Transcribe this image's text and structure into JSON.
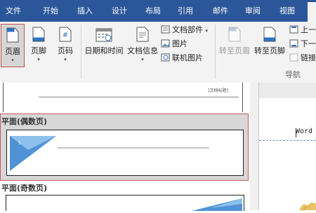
{
  "colors": {
    "ribbon_blue": "#2b579a",
    "selection_red": "#c0504d",
    "preview_blue": "#4f93d6"
  },
  "tabs": [
    "文件",
    "开始",
    "插入",
    "设计",
    "布局",
    "引用",
    "邮件",
    "审阅",
    "视图"
  ],
  "ribbon": {
    "header_button": {
      "label": "页眉",
      "icon": "header-icon"
    },
    "footer_button": {
      "label": "页脚",
      "icon": "footer-icon"
    },
    "page_number_button": {
      "label": "页码",
      "icon": "page-number-icon"
    },
    "date_time_button": {
      "label": "日期和时间",
      "icon": "calendar-icon"
    },
    "doc_info_button": {
      "label": "文档信息",
      "icon": "document-info-icon"
    },
    "doc_parts": "文档部件",
    "picture": "图片",
    "online_picture": "联机图片",
    "goto_header": "转至页眉",
    "goto_footer": "转至页脚",
    "prev": "上一",
    "next": "下一",
    "link": "链接",
    "group_nav": "导航",
    "dropdown_glyph": "▾"
  },
  "gallery": {
    "top_preview_tag": "[文档标题]",
    "even_section": "平面(偶数页)",
    "odd_section": "平面(奇数页)"
  },
  "document": {
    "text": "Word"
  }
}
